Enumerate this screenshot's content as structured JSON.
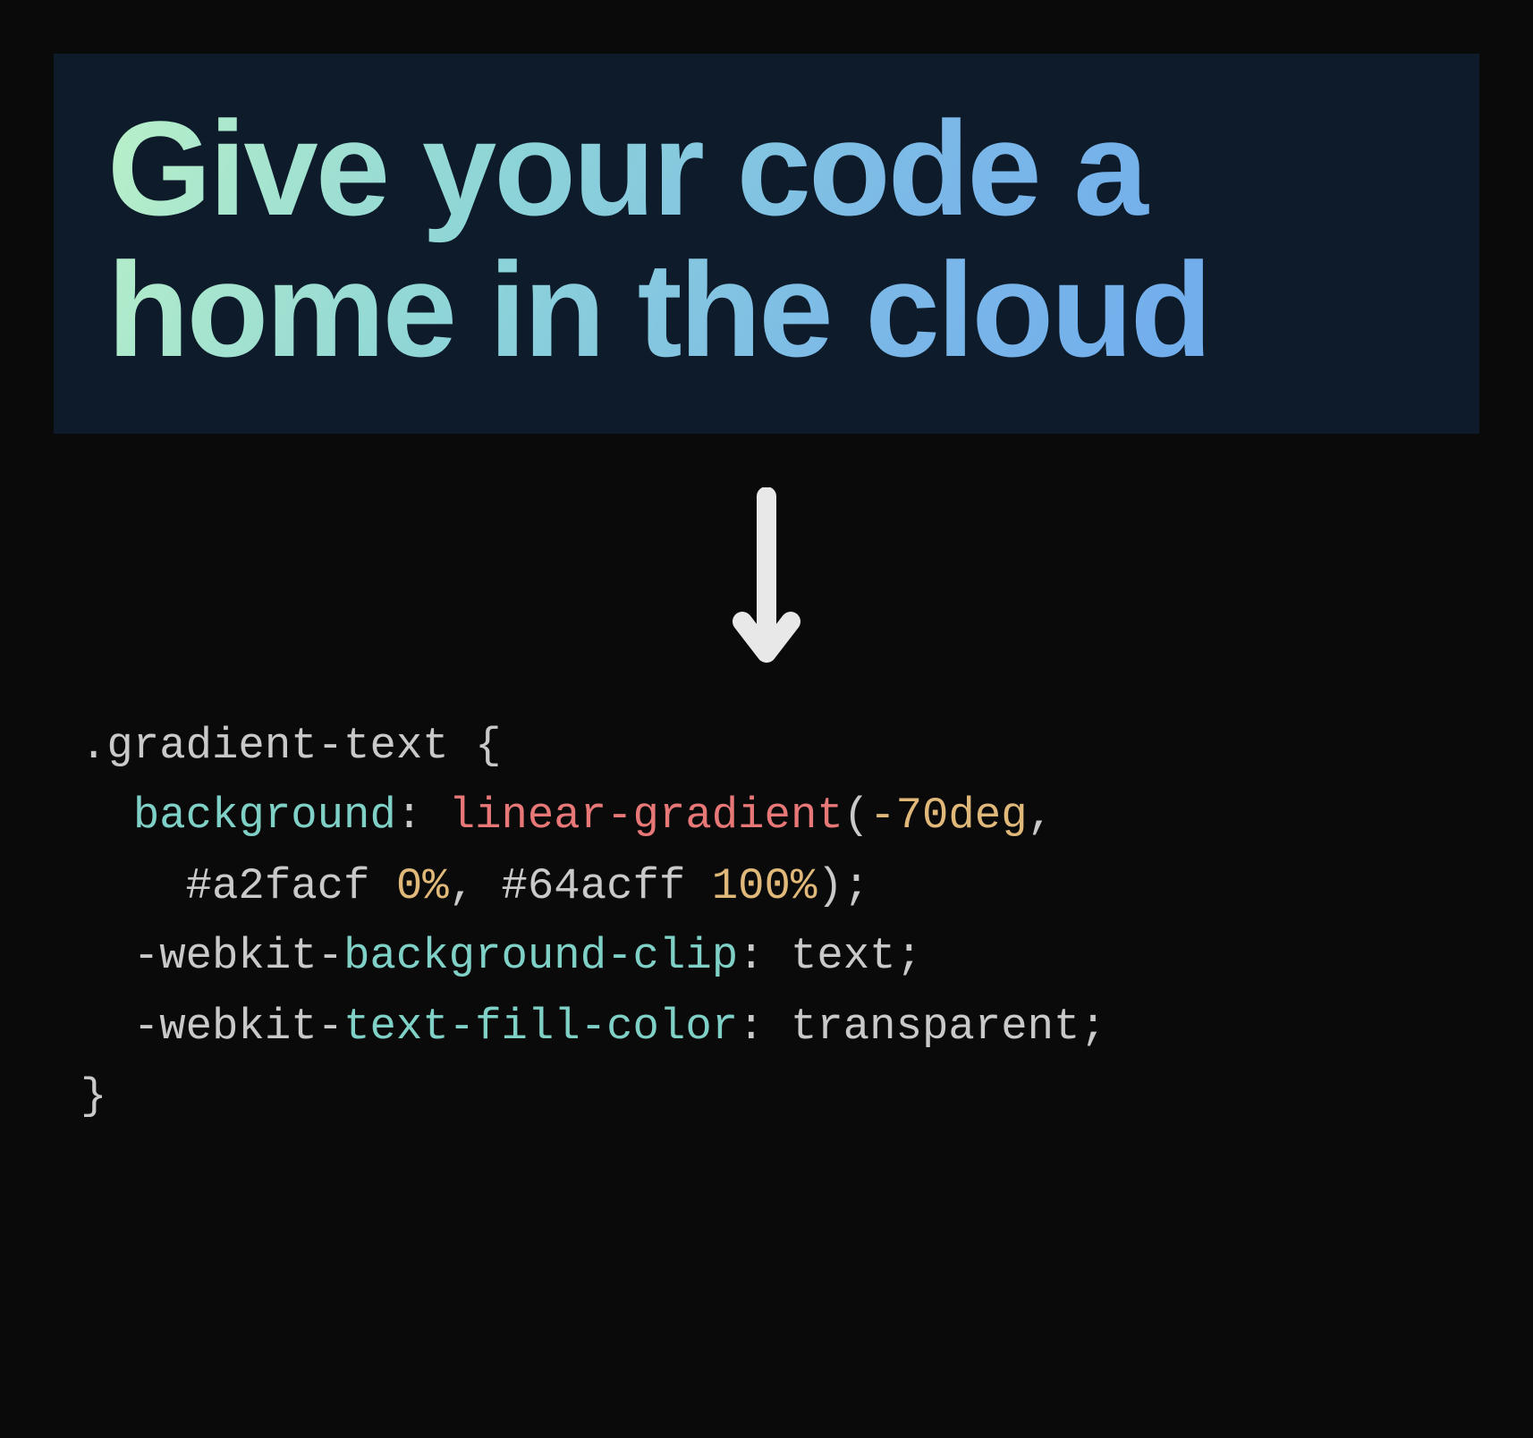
{
  "hero": {
    "text": "Give your code a home in the cloud"
  },
  "code": {
    "selector": ".gradient-text",
    "brace_open": "{",
    "brace_close": "}",
    "line1_prop": "background",
    "line1_func": "linear-gradient",
    "line1_arg1": "-70deg",
    "line1_comma1": ",",
    "line2_color1": "#a2facf",
    "line2_stop1": "0%",
    "line2_comma": ",",
    "line2_color2": "#64acff",
    "line2_stop2": "100%",
    "line2_close": ");",
    "line3_prefix": "-webkit-",
    "line3_prop": "background-clip",
    "line3_val": "text",
    "line3_semi": ";",
    "line4_prefix": "-webkit-",
    "line4_prop": "text-fill-color",
    "line4_val": "transparent",
    "line4_semi": ";",
    "colon": ":",
    "paren_open": "(",
    "space": " "
  }
}
